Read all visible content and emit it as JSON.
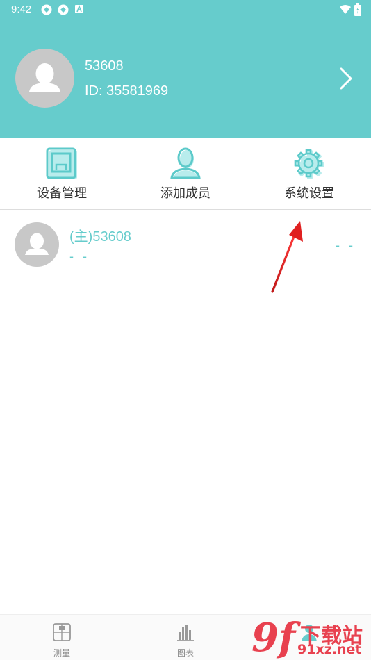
{
  "status_bar": {
    "time": "9:42"
  },
  "profile": {
    "name": "53608",
    "id_text": "ID: 35581969"
  },
  "actions": [
    {
      "label": "设备管理",
      "icon": "device-icon"
    },
    {
      "label": "添加成员",
      "icon": "person-icon"
    },
    {
      "label": "系统设置",
      "icon": "gear-icon"
    }
  ],
  "member": {
    "name": "(主)53608",
    "sub": "- -",
    "value": "- -"
  },
  "bottom_nav": [
    {
      "label": "测量",
      "icon": "measure-icon"
    },
    {
      "label": "图表",
      "icon": "chart-icon"
    }
  ],
  "watermark": {
    "brand_cn": "下载站",
    "brand_url": "91xz.net",
    "logo": "9f"
  },
  "colors": {
    "primary": "#66cccc",
    "annotation": "#e02020",
    "watermark": "#e8414f"
  }
}
